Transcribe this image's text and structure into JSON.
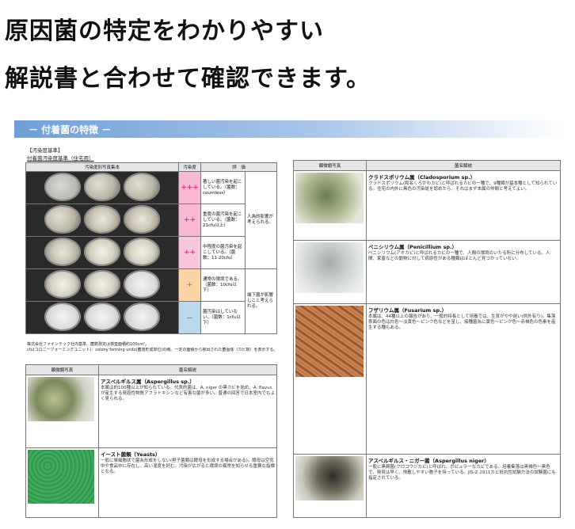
{
  "headline": {
    "line1": "原因菌の特定をわかりやすい",
    "line2": "解説書と合わせて確認できます。"
  },
  "section": {
    "title": "－ 付着菌の特徴 －"
  },
  "standards": {
    "heading": "【汚染度基準】",
    "subheading": "付着菌汚染度基準（住宅用）",
    "columns": [
      "汚染度別写真集本",
      "汚染度",
      "評　価"
    ],
    "rows": [
      {
        "grade": "+++",
        "desc": "著しい菌汚染を起こしている。（菌数：countless）",
        "note": ""
      },
      {
        "grade": "++",
        "desc": "重度の菌汚染を起こしている。（菌数：21cfu以上）",
        "note": "人為的影響が考えられる。"
      },
      {
        "grade": "++",
        "desc": "中程度の菌汚染を起こしている。（菌数：11-20cfu）",
        "note": ""
      },
      {
        "grade": "+",
        "desc": "通常の環境である。（菌数：10cfu以下）",
        "note": "端下菌が影響しこと考えられる。"
      },
      {
        "grade": "－",
        "desc": "菌汚染はしていない。（菌数：1cfu以下）",
        "note": ""
      }
    ],
    "footer1": "株式会社ファインテック社内基準。菌数測定は検査面積約100cm²。",
    "footer2": "cfu(コロニーフォーミングユニット)：colony forming units(菌落形成単位)の略。一定の面積から検出された菌個体（カビ数）を表示する。"
  },
  "fungi_left": {
    "columns": [
      "顕微鏡写真",
      "菌名解説"
    ],
    "items": [
      {
        "name": "アスペルギルス属（Aspergillus sp.）",
        "text": "本属は約100種以上が知られている。代表的菌は、A. niger の黒カビを始め、A. flavus が産生する発癌性物質アフラトキシンなど有害な菌が多い。普通の回答で日本室内でもよく見られる。"
      },
      {
        "name": "イースト菌類（Yeasts）",
        "text": "一般に単細胞状で菌糸形成をしない(担子菌類は酵母を形成する場合がある)。酵母は空気中や食品中に存在し、高い湿度を好む。汚染が広がると環境の異常を知らせる重要な指標となる。"
      }
    ]
  },
  "fungi_right": {
    "columns": [
      "顕微鏡写真",
      "菌名解説"
    ],
    "items": [
      {
        "name": "クラドスポリウム属（Cladosporium sp.）",
        "text": "クラドスポリウム(和名くろかわカビ)と呼ばれるカビの一種で、9種類が基本種として知られている。住宅の内外に黒色の汚染斑を認めたら、それはまず本属の仲間と考えてよい。"
      },
      {
        "name": "ペニシリウム属（Penicillium sp.）",
        "text": "ペニシリウム(アオカビ)と呼ばれるカビの一種で、人間の環境のいたる所に分布している。人間、家畜などの動物に対して病原性がある種類はほとんど見つかっていない。"
      },
      {
        "name": "フザリウム属（Fusarium sp.）",
        "text": "本属は、44種以上の報告があり、一般的特長として培養では、生育がやや遅い(例外有り)。集落表面の色は白色～淡黄色～ピンク色などを呈し、接種菌糸に黄色～ピンク色～赤褐色の色素を産生する種もある。"
      },
      {
        "name": "アスペルギルス・ニガー菌（Aspergillus niger）",
        "text": "一般に黒麹菌(クロコウジカビ)と呼ばれ、ポピュラーなカビである。培養集落は黒褐色～黒色で、発育は早く、飛散しやすい胞子を持っている。JIS-Z-2911カビ抵抗性試験方法の試験菌にも指定されている。"
      }
    ]
  }
}
